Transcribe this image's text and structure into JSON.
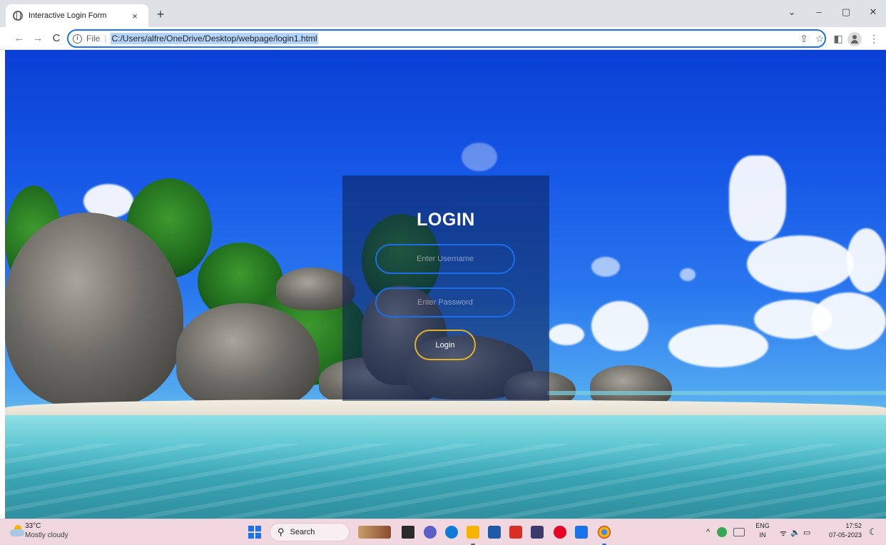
{
  "browser": {
    "tab_title": "Interactive Login Form",
    "tab_close": "×",
    "new_tab": "+",
    "window_controls": {
      "list": "⌄",
      "minimize": "–",
      "restore": "▢",
      "close": "✕"
    },
    "nav": {
      "back": "←",
      "forward": "→",
      "reload": "C"
    },
    "address": {
      "info": "i",
      "scheme": "File",
      "separator": "|",
      "url": "C:/Users/alfre/OneDrive/Desktop/webpage/login1.html"
    },
    "toolbar_icons": {
      "share": "⇪",
      "bookmark": "☆",
      "side_panel": "◧",
      "menu": "⋮"
    }
  },
  "login": {
    "title": "LOGIN",
    "username_placeholder": "Enter Username",
    "password_placeholder": "Enter Password",
    "button_label": "Login"
  },
  "taskbar": {
    "weather": {
      "temp": "33°C",
      "desc": "Mostly cloudy"
    },
    "search_label": "Search",
    "search_glyph": "⚲",
    "tray": {
      "chevron": "^",
      "lang_top": "ENG",
      "lang_bottom": "IN",
      "wifi": "ᯤ",
      "volume": "🔈",
      "battery": "▭",
      "time": "17:52",
      "date": "07-05-2023",
      "moon": "☾"
    },
    "colors": {
      "edge": "#0f7bd7",
      "chrome": "#f4b400",
      "mcafee": "#d93025",
      "pinterest": "#e60023",
      "vscode": "#1a73e8"
    }
  }
}
